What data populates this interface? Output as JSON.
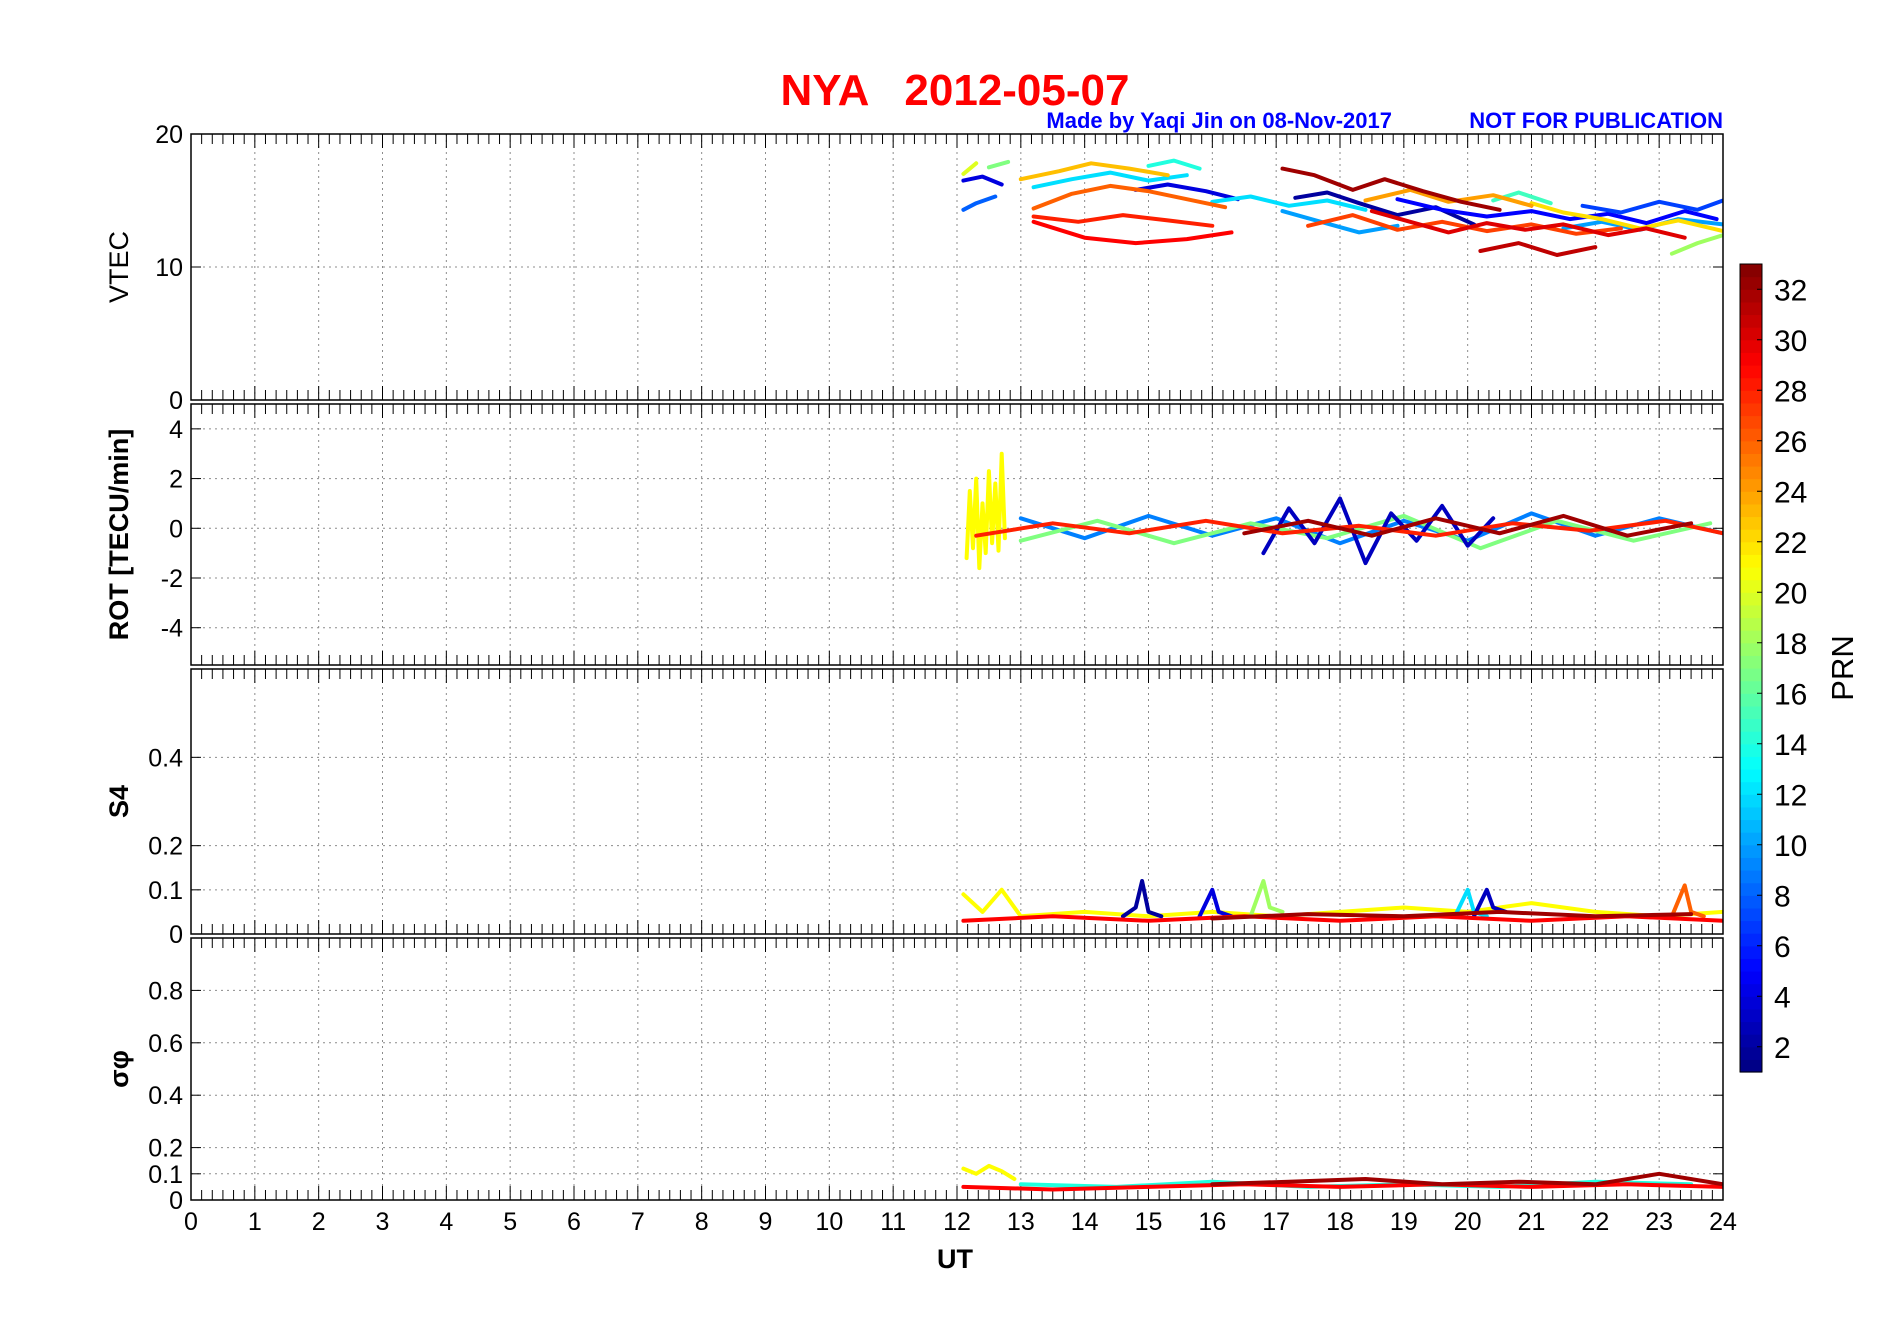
{
  "chart_data": {
    "type": "line",
    "title": "NYA   2012-05-07",
    "credit": "Made by Yaqi Jin on 08-Nov-2017",
    "notice": "NOT FOR PUBLICATION",
    "xlabel": "UT",
    "xlim": [
      0,
      24
    ],
    "xticks": [
      "0",
      "1",
      "2",
      "3",
      "4",
      "5",
      "6",
      "7",
      "8",
      "9",
      "10",
      "11",
      "12",
      "13",
      "14",
      "15",
      "16",
      "17",
      "18",
      "19",
      "20",
      "21",
      "22",
      "23",
      "24"
    ],
    "colors": {
      "title": "#ff0000",
      "note": "#0000ff"
    },
    "colorbar": {
      "label": "PRN",
      "range": [
        1,
        33
      ],
      "ticks": [
        "2",
        "4",
        "6",
        "8",
        "10",
        "12",
        "14",
        "16",
        "18",
        "20",
        "22",
        "24",
        "26",
        "28",
        "30",
        "32"
      ],
      "colormap": "jet"
    },
    "panels": [
      {
        "id": "vtec",
        "ylabel": "VTEC",
        "ylim": [
          0,
          20
        ],
        "yticks": [
          "0",
          "10",
          "20"
        ],
        "grid": true,
        "series": [
          {
            "prn": 2,
            "x": [
              17.3,
              17.8,
              18.3,
              18.9,
              19.5,
              20.1
            ],
            "y": [
              15.2,
              15.6,
              14.8,
              13.9,
              14.5,
              13.2
            ]
          },
          {
            "prn": 4,
            "x": [
              12.1,
              12.4,
              12.7
            ],
            "y": [
              16.5,
              16.8,
              16.2
            ]
          },
          {
            "prn": 4,
            "x": [
              14.8,
              15.3,
              15.9,
              16.4
            ],
            "y": [
              15.8,
              16.2,
              15.7,
              15.1
            ]
          },
          {
            "prn": 5,
            "x": [
              18.9,
              19.6,
              20.3,
              21.0,
              21.6,
              22.2,
              22.8,
              23.4,
              23.9
            ],
            "y": [
              15.1,
              14.3,
              13.8,
              14.2,
              13.6,
              14.0,
              13.3,
              14.2,
              13.6
            ]
          },
          {
            "prn": 7,
            "x": [
              21.8,
              22.4,
              23.0,
              23.6,
              24.0
            ],
            "y": [
              14.6,
              14.1,
              14.9,
              14.3,
              15.0
            ]
          },
          {
            "prn": 8,
            "x": [
              12.1,
              12.3,
              12.6
            ],
            "y": [
              14.3,
              14.8,
              15.3
            ]
          },
          {
            "prn": 10,
            "x": [
              17.1,
              17.7,
              18.3,
              18.9
            ],
            "y": [
              14.2,
              13.4,
              12.6,
              13.1
            ]
          },
          {
            "prn": 10,
            "x": [
              21.5,
              22.1,
              22.7,
              23.3,
              24.0
            ],
            "y": [
              12.9,
              13.4,
              12.8,
              13.6,
              13.2
            ]
          },
          {
            "prn": 12,
            "x": [
              13.2,
              13.8,
              14.4,
              15.0,
              15.6
            ],
            "y": [
              16.0,
              16.6,
              17.1,
              16.5,
              16.9
            ]
          },
          {
            "prn": 12,
            "x": [
              16.0,
              16.6,
              17.2,
              17.8,
              18.4
            ],
            "y": [
              14.9,
              15.3,
              14.6,
              15.0,
              14.3
            ]
          },
          {
            "prn": 14,
            "x": [
              15.0,
              15.4,
              15.8
            ],
            "y": [
              17.6,
              18.0,
              17.4
            ]
          },
          {
            "prn": 15,
            "x": [
              20.4,
              20.8,
              21.3
            ],
            "y": [
              15.0,
              15.6,
              14.8
            ]
          },
          {
            "prn": 17,
            "x": [
              12.5,
              12.8
            ],
            "y": [
              17.5,
              17.9
            ]
          },
          {
            "prn": 18,
            "x": [
              23.2,
              23.6,
              24.0
            ],
            "y": [
              11.0,
              11.8,
              12.4
            ]
          },
          {
            "prn": 20,
            "x": [
              12.1,
              12.3
            ],
            "y": [
              17.0,
              17.8
            ]
          },
          {
            "prn": 22,
            "x": [
              21.0,
              21.5,
              22.1,
              22.7,
              23.3,
              24.0
            ],
            "y": [
              14.8,
              14.1,
              13.6,
              12.9,
              13.5,
              12.7
            ]
          },
          {
            "prn": 23,
            "x": [
              13.0,
              13.6,
              14.1,
              14.7,
              15.3
            ],
            "y": [
              16.6,
              17.2,
              17.8,
              17.4,
              16.9
            ]
          },
          {
            "prn": 24,
            "x": [
              18.4,
              19.1,
              19.7,
              20.4,
              21.0
            ],
            "y": [
              15.0,
              15.8,
              14.9,
              15.4,
              14.6
            ]
          },
          {
            "prn": 26,
            "x": [
              13.2,
              13.8,
              14.4,
              15.0,
              15.6,
              16.2
            ],
            "y": [
              14.4,
              15.5,
              16.1,
              15.7,
              15.1,
              14.5
            ]
          },
          {
            "prn": 27,
            "x": [
              17.5,
              18.2,
              18.9,
              19.6,
              20.3,
              21.0,
              21.7,
              22.4
            ],
            "y": [
              13.1,
              13.9,
              12.8,
              13.4,
              12.7,
              13.2,
              12.5,
              12.9
            ]
          },
          {
            "prn": 28,
            "x": [
              13.2,
              13.9,
              14.6,
              15.3,
              16.0
            ],
            "y": [
              13.8,
              13.4,
              13.9,
              13.5,
              13.1
            ]
          },
          {
            "prn": 29,
            "x": [
              13.2,
              14.0,
              14.8,
              15.6,
              16.3
            ],
            "y": [
              13.4,
              12.2,
              11.8,
              12.1,
              12.6
            ]
          },
          {
            "prn": 30,
            "x": [
              18.5,
              19.1,
              19.7,
              20.3,
              20.9,
              21.5,
              22.2,
              22.8,
              23.4
            ],
            "y": [
              14.2,
              13.4,
              12.6,
              13.3,
              12.8,
              13.2,
              12.4,
              12.9,
              12.2
            ]
          },
          {
            "prn": 31,
            "x": [
              20.2,
              20.8,
              21.4,
              22.0
            ],
            "y": [
              11.2,
              11.8,
              10.9,
              11.5
            ]
          },
          {
            "prn": 32,
            "x": [
              17.1,
              17.6,
              18.2,
              18.7,
              19.3,
              19.9,
              20.5
            ],
            "y": [
              17.4,
              16.9,
              15.8,
              16.6,
              15.7,
              14.9,
              14.3
            ]
          }
        ]
      },
      {
        "id": "rot",
        "ylabel": "ROT [TECU/min]",
        "ylim": [
          -5.5,
          5
        ],
        "yticks": [
          "4",
          "2",
          "0",
          "-2",
          "-4"
        ],
        "grid": true,
        "series": [
          {
            "prn": 21,
            "x": [
              12.15,
              12.2,
              12.25,
              12.3,
              12.35,
              12.4,
              12.45,
              12.5,
              12.55,
              12.6,
              12.65,
              12.7,
              12.75
            ],
            "y": [
              -1.2,
              1.5,
              -0.8,
              2.0,
              -1.6,
              1.0,
              -1.0,
              2.3,
              -0.6,
              1.8,
              -0.9,
              3.0,
              -0.4
            ]
          },
          {
            "prn": 9,
            "x": [
              13.0,
              14.0,
              15.0,
              16.0,
              17.0,
              18.0,
              19.0,
              20.0,
              21.0,
              22.0,
              23.0,
              24.0
            ],
            "y": [
              0.4,
              -0.4,
              0.5,
              -0.3,
              0.4,
              -0.6,
              0.3,
              -0.5,
              0.6,
              -0.3,
              0.4,
              -0.2
            ]
          },
          {
            "prn": 17,
            "x": [
              13.0,
              14.2,
              15.4,
              16.6,
              17.8,
              19.0,
              20.2,
              21.4,
              22.6,
              23.8
            ],
            "y": [
              -0.5,
              0.3,
              -0.6,
              0.2,
              -0.4,
              0.5,
              -0.8,
              0.3,
              -0.5,
              0.2
            ]
          },
          {
            "prn": 3,
            "x": [
              16.8,
              17.2,
              17.6,
              18.0,
              18.4,
              18.8,
              19.2,
              19.6,
              20.0,
              20.4
            ],
            "y": [
              -1.0,
              0.8,
              -0.6,
              1.2,
              -1.4,
              0.6,
              -0.5,
              0.9,
              -0.7,
              0.4
            ]
          },
          {
            "prn": 28,
            "x": [
              12.3,
              13.5,
              14.7,
              15.9,
              17.1,
              18.3,
              19.5,
              20.7,
              21.9,
              23.1,
              24.0
            ],
            "y": [
              -0.3,
              0.2,
              -0.2,
              0.3,
              -0.2,
              0.1,
              -0.3,
              0.2,
              -0.1,
              0.3,
              -0.2
            ]
          },
          {
            "prn": 32,
            "x": [
              16.5,
              17.5,
              18.5,
              19.5,
              20.5,
              21.5,
              22.5,
              23.5
            ],
            "y": [
              -0.2,
              0.3,
              -0.3,
              0.4,
              -0.2,
              0.5,
              -0.3,
              0.2
            ]
          }
        ]
      },
      {
        "id": "s4",
        "ylabel": "S4",
        "ylim": [
          0,
          0.6
        ],
        "yticks": [
          "0",
          "0.1",
          "0.2",
          "0.4"
        ],
        "grid": true,
        "series": [
          {
            "prn": 21,
            "x": [
              12.1,
              12.4,
              12.7,
              13.0,
              14.0,
              15.0,
              16.0,
              17.0,
              18.0,
              19.0,
              20.0,
              21.0,
              22.0,
              23.0,
              24.0
            ],
            "y": [
              0.09,
              0.05,
              0.1,
              0.04,
              0.05,
              0.04,
              0.05,
              0.04,
              0.05,
              0.06,
              0.05,
              0.07,
              0.05,
              0.04,
              0.05
            ]
          },
          {
            "prn": 2,
            "x": [
              14.6,
              14.8,
              14.9,
              15.0,
              15.2
            ],
            "y": [
              0.04,
              0.06,
              0.12,
              0.05,
              0.04
            ]
          },
          {
            "prn": 4,
            "x": [
              15.8,
              16.0,
              16.1,
              16.3
            ],
            "y": [
              0.04,
              0.1,
              0.05,
              0.04
            ]
          },
          {
            "prn": 18,
            "x": [
              16.6,
              16.8,
              16.9,
              17.1
            ],
            "y": [
              0.04,
              0.12,
              0.06,
              0.05
            ]
          },
          {
            "prn": 12,
            "x": [
              19.8,
              20.0,
              20.1,
              20.3
            ],
            "y": [
              0.04,
              0.1,
              0.05,
              0.04
            ]
          },
          {
            "prn": 3,
            "x": [
              20.1,
              20.3,
              20.4,
              20.6
            ],
            "y": [
              0.04,
              0.1,
              0.06,
              0.05
            ]
          },
          {
            "prn": 26,
            "x": [
              23.2,
              23.4,
              23.5,
              23.7
            ],
            "y": [
              0.04,
              0.11,
              0.05,
              0.04
            ]
          },
          {
            "prn": 29,
            "x": [
              12.1,
              13.5,
              15.0,
              16.5,
              18.0,
              19.5,
              21.0,
              22.5,
              24.0
            ],
            "y": [
              0.03,
              0.04,
              0.03,
              0.04,
              0.03,
              0.04,
              0.03,
              0.04,
              0.03
            ]
          },
          {
            "prn": 32,
            "x": [
              16.0,
              17.5,
              19.0,
              20.5,
              22.0,
              23.5
            ],
            "y": [
              0.035,
              0.045,
              0.04,
              0.05,
              0.04,
              0.045
            ]
          }
        ]
      },
      {
        "id": "sigphi",
        "ylabel": "σφ",
        "ylim": [
          0,
          1
        ],
        "yticks": [
          "0",
          "0.1",
          "0.2",
          "0.4",
          "0.6",
          "0.8"
        ],
        "grid": true,
        "series": [
          {
            "prn": 21,
            "x": [
              12.1,
              12.3,
              12.5,
              12.7,
              12.9
            ],
            "y": [
              0.12,
              0.1,
              0.13,
              0.11,
              0.08
            ]
          },
          {
            "prn": 14,
            "x": [
              13.0,
              14.5,
              16.0,
              17.5,
              19.0,
              20.5,
              22.0,
              23.5
            ],
            "y": [
              0.06,
              0.05,
              0.07,
              0.05,
              0.06,
              0.05,
              0.07,
              0.06
            ]
          },
          {
            "prn": 29,
            "x": [
              12.1,
              13.5,
              15.0,
              16.5,
              18.0,
              19.5,
              21.0,
              22.5,
              24.0
            ],
            "y": [
              0.05,
              0.04,
              0.05,
              0.06,
              0.05,
              0.06,
              0.05,
              0.06,
              0.05
            ]
          },
          {
            "prn": 32,
            "x": [
              16.0,
              17.2,
              18.4,
              19.6,
              20.8,
              22.0,
              23.0,
              24.0
            ],
            "y": [
              0.06,
              0.07,
              0.08,
              0.06,
              0.07,
              0.06,
              0.1,
              0.06
            ]
          }
        ]
      }
    ]
  }
}
